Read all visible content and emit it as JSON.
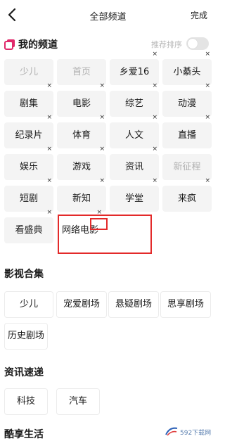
{
  "header": {
    "title": "全部频道",
    "done_label": "完成"
  },
  "my_channels": {
    "title": "我的频道",
    "sort_label": "推荐排序",
    "sort_enabled": false,
    "items": [
      {
        "label": "少儿",
        "fixed": true,
        "removable": false
      },
      {
        "label": "首页",
        "fixed": true,
        "removable": false
      },
      {
        "label": "乡爱16",
        "fixed": false,
        "removable": true
      },
      {
        "label": "小綦头",
        "fixed": false,
        "removable": true
      },
      {
        "label": "剧集",
        "fixed": false,
        "removable": true
      },
      {
        "label": "电影",
        "fixed": false,
        "removable": true
      },
      {
        "label": "综艺",
        "fixed": false,
        "removable": true
      },
      {
        "label": "动漫",
        "fixed": false,
        "removable": true
      },
      {
        "label": "纪录片",
        "fixed": false,
        "removable": true
      },
      {
        "label": "体育",
        "fixed": false,
        "removable": true
      },
      {
        "label": "人文",
        "fixed": false,
        "removable": true
      },
      {
        "label": "直播",
        "fixed": false,
        "removable": true
      },
      {
        "label": "娱乐",
        "fixed": false,
        "removable": true
      },
      {
        "label": "游戏",
        "fixed": false,
        "removable": true
      },
      {
        "label": "资讯",
        "fixed": false,
        "removable": true
      },
      {
        "label": "新征程",
        "fixed": true,
        "removable": false
      },
      {
        "label": "短剧",
        "fixed": false,
        "removable": true
      },
      {
        "label": "新知",
        "fixed": false,
        "removable": true
      },
      {
        "label": "学堂",
        "fixed": false,
        "removable": true
      },
      {
        "label": "来疯",
        "fixed": false,
        "removable": true
      },
      {
        "label": "看盛典",
        "fixed": false,
        "removable": true
      },
      {
        "label": "网络电影",
        "fixed": false,
        "removable": true
      }
    ]
  },
  "collections": {
    "title": "影视合集",
    "items": [
      "少儿",
      "宠爱剧场",
      "悬疑剧场",
      "思享剧场",
      "历史剧场"
    ]
  },
  "news": {
    "title": "资讯速递",
    "items": [
      "科技",
      "汽车"
    ]
  },
  "lifestyle": {
    "title": "酷享生活"
  },
  "watermark": {
    "text": "592下载网"
  },
  "colors": {
    "highlight": "#e32a2a",
    "brand_icon": "#e0286a"
  }
}
